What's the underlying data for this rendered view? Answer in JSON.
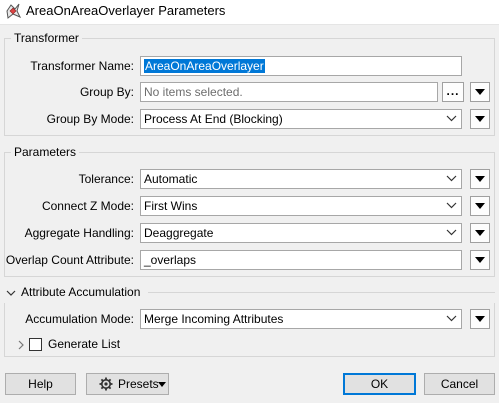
{
  "window": {
    "title": "AreaOnAreaOverlayer Parameters"
  },
  "transformer_group": {
    "title": "Transformer",
    "name_label": "Transformer Name:",
    "name_value": "AreaOnAreaOverlayer",
    "group_by_label": "Group By:",
    "group_by_placeholder": "No items selected.",
    "group_by_dots": "...",
    "group_by_mode_label": "Group By Mode:",
    "group_by_mode_value": "Process At End (Blocking)"
  },
  "parameters_group": {
    "title": "Parameters",
    "tolerance_label": "Tolerance:",
    "tolerance_value": "Automatic",
    "connect_z_label": "Connect Z Mode:",
    "connect_z_value": "First Wins",
    "aggregate_label": "Aggregate Handling:",
    "aggregate_value": "Deaggregate",
    "overlap_label": "Overlap Count Attribute:",
    "overlap_value": "_overlaps"
  },
  "attribute_accumulation": {
    "title": "Attribute Accumulation",
    "mode_label": "Accumulation Mode:",
    "mode_value": "Merge Incoming Attributes",
    "generate_list_label": "Generate List",
    "generate_list_checked": false
  },
  "footer": {
    "help_label": "Help",
    "presets_label": "Presets",
    "ok_label": "OK",
    "cancel_label": "Cancel"
  },
  "icons": {
    "app": "fme-transformer-icon",
    "chevron": "chevron-down-icon",
    "menu": "triangle-down-icon",
    "gear": "gear-icon"
  },
  "colors": {
    "selection": "#0078d7",
    "window_bg": "#f0f0f0"
  }
}
